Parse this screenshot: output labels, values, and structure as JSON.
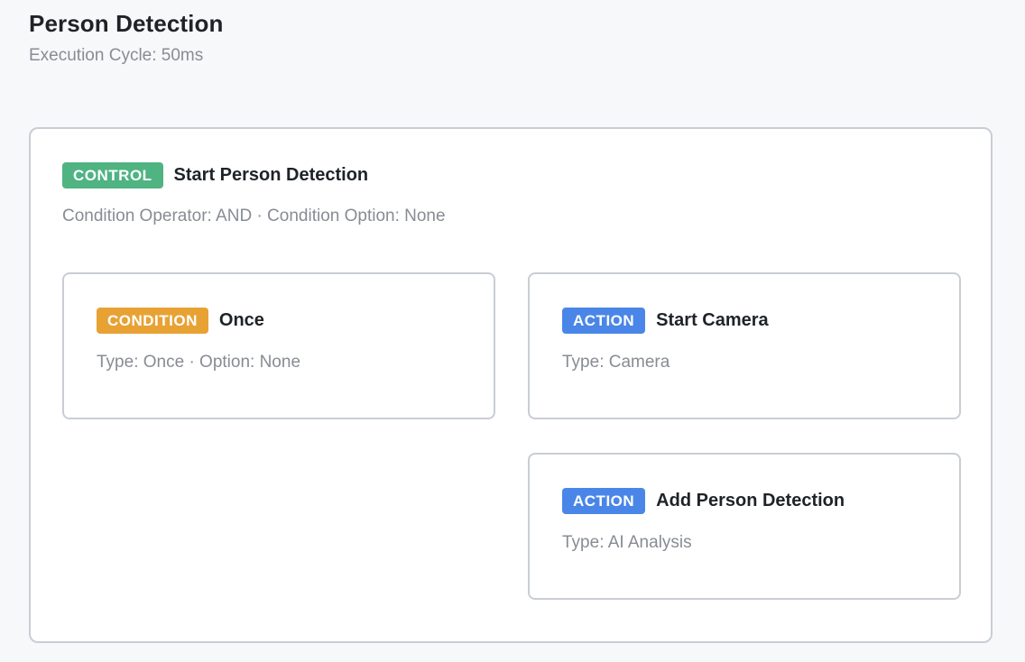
{
  "page": {
    "title": "Person Detection",
    "subtitle": "Execution Cycle: 50ms"
  },
  "control": {
    "badge": "CONTROL",
    "title": "Start Person Detection",
    "meta": "Condition Operator: AND · Condition Option: None"
  },
  "condition": {
    "badge": "CONDITION",
    "title": "Once",
    "meta": "Type: Once · Option: None"
  },
  "actions": [
    {
      "badge": "ACTION",
      "title": "Start Camera",
      "meta": "Type: Camera"
    },
    {
      "badge": "ACTION",
      "title": "Add Person Detection",
      "meta": "Type: AI Analysis"
    }
  ],
  "colors": {
    "control": "#4fb382",
    "condition": "#e8a234",
    "action": "#4a86e8",
    "border": "#c9cdd4",
    "background": "#f7f8fa"
  }
}
